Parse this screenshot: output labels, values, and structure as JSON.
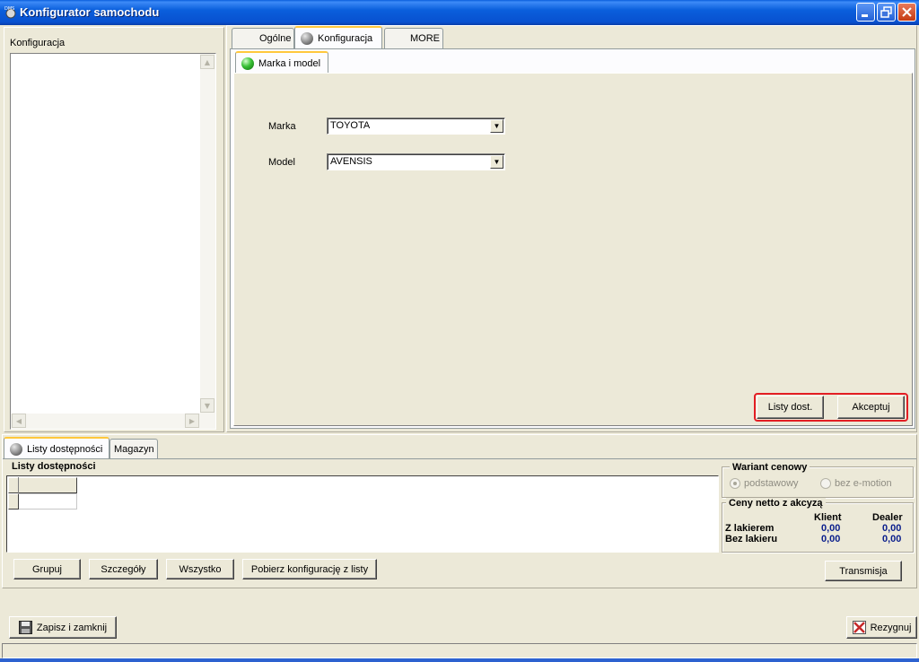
{
  "window": {
    "title": "Konfigurator samochodu",
    "icon": "app-logo-icon",
    "controls": [
      "minimize-icon",
      "restore-icon",
      "close-icon"
    ]
  },
  "left_panel": {
    "label": "Konfiguracja"
  },
  "top_tabs": [
    {
      "label": "Ogólne"
    },
    {
      "label": "Konfiguracja"
    },
    {
      "label": "MORE"
    }
  ],
  "subtab": {
    "label": "Marka i model"
  },
  "form": {
    "marka_label": "Marka",
    "marka_value": "TOYOTA",
    "model_label": "Model",
    "model_value": "AVENSIS"
  },
  "buttons": {
    "listy_dost": "Listy dost.",
    "akceptuj": "Akceptuj",
    "grupuj": "Grupuj",
    "szczegoly": "Szczegóły",
    "wszystko": "Wszystko",
    "pobierz": "Pobierz konfigurację z listy",
    "transmisja": "Transmisja",
    "zapisz": "Zapisz i zamknij",
    "rezygnuj": "Rezygnuj"
  },
  "bottom_tabs": [
    {
      "label": "Listy dostępności"
    },
    {
      "label": "Magazyn"
    }
  ],
  "availability": {
    "heading": "Listy dostępności"
  },
  "price_variant": {
    "heading": "Wariant cenowy",
    "option_basic": "podstawowy",
    "option_emotion": "bez e-motion"
  },
  "net_prices": {
    "heading": "Ceny netto z akcyzą",
    "col_client": "Klient",
    "col_dealer": "Dealer",
    "row1_label": "Z lakierem",
    "row1_client": "0,00",
    "row1_dealer": "0,00",
    "row2_label": "Bez lakieru",
    "row2_client": "0,00",
    "row2_dealer": "0,00"
  },
  "colors": {
    "highlight": "#e31e24",
    "titlebar": "#0a5fdc",
    "price_value": "#0a1e8c"
  }
}
